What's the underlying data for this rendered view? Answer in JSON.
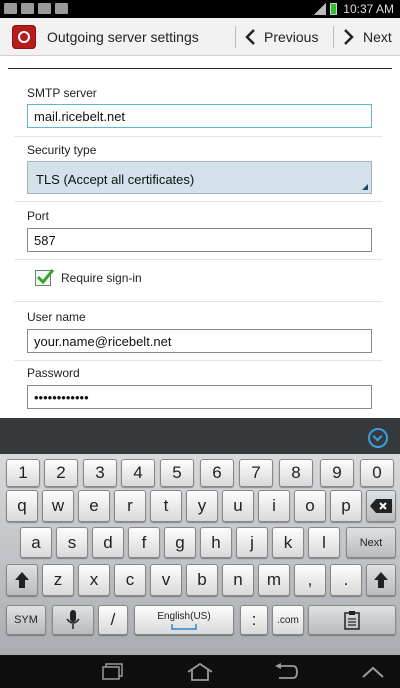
{
  "status_bar": {
    "time": "10:37 AM"
  },
  "action_bar": {
    "title": "Outgoing server settings",
    "previous_label": "Previous",
    "next_label": "Next"
  },
  "form": {
    "smtp_label": "SMTP server",
    "smtp_value": "mail.ricebelt.net",
    "security_label": "Security type",
    "security_value": "TLS (Accept all certificates)",
    "port_label": "Port",
    "port_value": "587",
    "require_signin_label": "Require sign-in",
    "require_signin_checked": true,
    "username_label": "User name",
    "username_value": "your.name@ricebelt.net",
    "password_label": "Password",
    "password_value": "••••••••••••"
  },
  "keyboard": {
    "number_row": [
      "1",
      "2",
      "3",
      "4",
      "5",
      "6",
      "7",
      "8",
      "9",
      "0"
    ],
    "row1": [
      "q",
      "w",
      "e",
      "r",
      "t",
      "y",
      "u",
      "i",
      "o",
      "p"
    ],
    "row2": [
      "a",
      "s",
      "d",
      "f",
      "g",
      "h",
      "j",
      "k",
      "l"
    ],
    "row3": [
      "z",
      "x",
      "c",
      "v",
      "b",
      "n",
      "m"
    ],
    "next_label": "Next",
    "sym_label": "SYM",
    "slash_label": "/",
    "space_label": "English(US)",
    "colon_label": ":",
    "dotcom_label": ".com",
    "comma_label": ",",
    "period_label": "."
  },
  "colors": {
    "accent": "#5fb3d6",
    "checkbox_green": "#3aa52d"
  }
}
